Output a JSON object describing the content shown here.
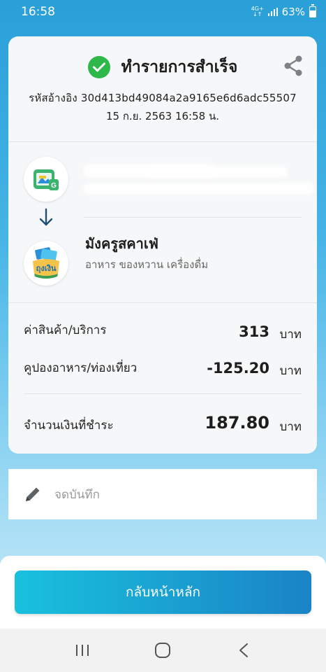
{
  "status_bar": {
    "time": "16:58",
    "network": "4G+",
    "battery_percent": "63%",
    "battery_level": 0.63
  },
  "receipt": {
    "title": "ทำรายการสำเร็จ",
    "reference": "รหัสอ้างอิง 30d413bd49084a2a9165e6d6adc55507",
    "datetime": "15 ก.ย. 2563 16:58 น."
  },
  "merchant": {
    "name": "มังครูสคาเฟ่",
    "category": "อาหาร ของหวาน เครื่องดื่ม",
    "logo_text": "ถุงเงิน"
  },
  "amounts": {
    "goods_label": "ค่าสินค้า/บริการ",
    "goods_value": "313",
    "coupon_label": "คูปองอาหาร/ท่องเที่ยว",
    "coupon_value": "-125.20",
    "total_label": "จำนวนเงินที่ชำระ",
    "total_value": "187.80",
    "unit": "บาท"
  },
  "note": {
    "placeholder": "จดบันทึก"
  },
  "actions": {
    "home_button": "กลับหน้าหลัก"
  },
  "icons": {
    "success": "check-circle-icon",
    "share": "share-icon",
    "wallet": "g-wallet-icon",
    "transfer": "arrow-down-icon",
    "merchant": "thung-ngoen-icon",
    "edit": "pencil-icon"
  },
  "colors": {
    "accent": "#1a83c6",
    "success": "#2fb84a",
    "button_start": "#19c1dd",
    "button_end": "#1a83c6"
  }
}
